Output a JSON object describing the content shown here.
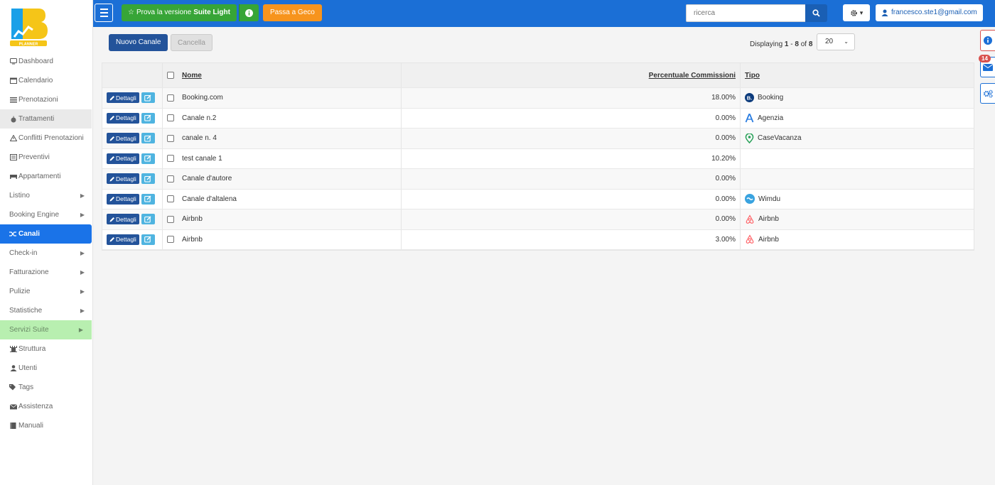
{
  "topbar": {
    "suite_prefix": "Prova la versione",
    "suite_bold": "Suite Light",
    "geco_label": "Passa a Geco",
    "search_placeholder": "ricerca",
    "user_email": "francesco.ste1@gmail.com"
  },
  "sidebar": {
    "items": [
      {
        "label": "Dashboard",
        "icon": "monitor-icon"
      },
      {
        "label": "Calendario",
        "icon": "calendar-icon"
      },
      {
        "label": "Prenotazioni",
        "icon": "list-icon"
      },
      {
        "label": "Trattamenti",
        "icon": "apple-icon"
      },
      {
        "label": "Conflitti Prenotazioni",
        "icon": "warning-icon"
      },
      {
        "label": "Preventivi",
        "icon": "document-icon"
      },
      {
        "label": "Appartamenti",
        "icon": "bed-icon"
      },
      {
        "label": "Listino"
      },
      {
        "label": "Booking Engine"
      },
      {
        "label": "Canali",
        "icon": "shuffle-icon"
      },
      {
        "label": "Check-in"
      },
      {
        "label": "Fatturazione"
      },
      {
        "label": "Pulizie"
      },
      {
        "label": "Statistiche"
      },
      {
        "label": "Servizi Suite"
      },
      {
        "label": "Struttura",
        "icon": "tower-icon"
      },
      {
        "label": "Utenti",
        "icon": "user-icon"
      },
      {
        "label": "Tags",
        "icon": "tags-icon"
      },
      {
        "label": "Assistenza",
        "icon": "envelope-icon"
      },
      {
        "label": "Manuali",
        "icon": "book-icon"
      }
    ]
  },
  "toolbar": {
    "new_label": "Nuovo Canale",
    "delete_label": "Cancella",
    "displaying_prefix": "Displaying",
    "range_start": "1",
    "range_sep": "-",
    "range_end": "8",
    "of_label": "of",
    "total": "8",
    "page_size": "20"
  },
  "table": {
    "headers": {
      "nome": "Nome",
      "perc": "Percentuale Commissioni",
      "tipo": "Tipo"
    },
    "details_label": "Dettagli",
    "rows": [
      {
        "nome": "Booking.com",
        "perc": "18.00%",
        "tipo": "Booking",
        "tipo_icon": "booking-icon"
      },
      {
        "nome": "Canale n.2",
        "perc": "0.00%",
        "tipo": "Agenzia",
        "tipo_icon": "agenzia-icon"
      },
      {
        "nome": "canale n. 4",
        "perc": "0.00%",
        "tipo": "CaseVacanza",
        "tipo_icon": "casevacanza-icon"
      },
      {
        "nome": "test canale 1",
        "perc": "10.20%",
        "tipo": "",
        "tipo_icon": ""
      },
      {
        "nome": "Canale d'autore",
        "perc": "0.00%",
        "tipo": "",
        "tipo_icon": ""
      },
      {
        "nome": "Canale d'altalena",
        "perc": "0.00%",
        "tipo": "Wimdu",
        "tipo_icon": "wimdu-icon"
      },
      {
        "nome": "Airbnb",
        "perc": "0.00%",
        "tipo": "Airbnb",
        "tipo_icon": "airbnb-icon"
      },
      {
        "nome": "Airbnb",
        "perc": "3.00%",
        "tipo": "Airbnb",
        "tipo_icon": "airbnb-icon"
      }
    ]
  },
  "side": {
    "mail_count": "14"
  },
  "colors": {
    "primary": "#1b6fd6",
    "active": "#1a73e8",
    "suite": "#37a537",
    "geco": "#f7941d",
    "dark_button": "#23539a"
  }
}
